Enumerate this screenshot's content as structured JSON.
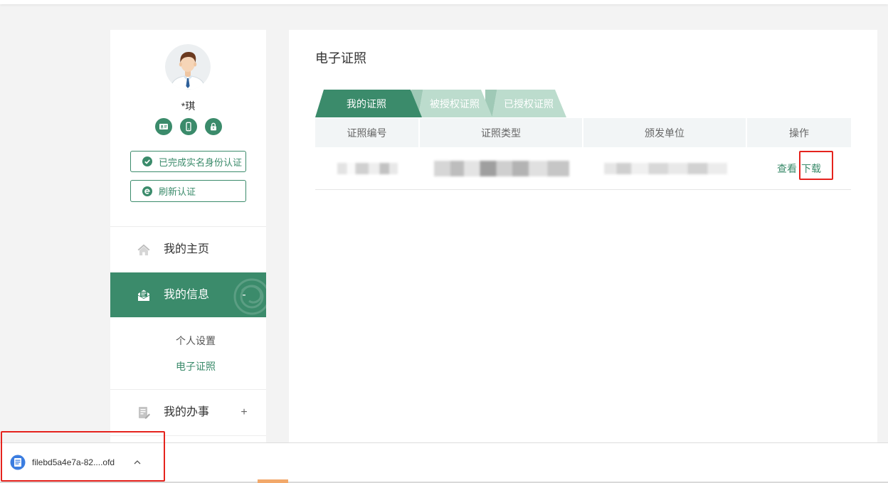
{
  "user": {
    "name": "*琪",
    "avatar": "avatar-man-icon",
    "badges": [
      "id-card-icon",
      "phone-icon",
      "lock-icon"
    ]
  },
  "auth": {
    "verified_label": "已完成实名身份认证",
    "verified_icon": "check-circle-icon",
    "refresh_label": "刷新认证",
    "refresh_icon": "refresh-icon"
  },
  "nav": {
    "home": {
      "label": "我的主页",
      "icon": "home-icon"
    },
    "info": {
      "label": "我的信息",
      "icon": "envelope-icon",
      "toggle": "-",
      "expanded": true,
      "sub_items": [
        {
          "label": "个人设置",
          "active": false
        },
        {
          "label": "电子证照",
          "active": true
        }
      ]
    },
    "affairs": {
      "label": "我的办事",
      "icon": "affairs-icon",
      "toggle": "+",
      "expanded": false
    }
  },
  "main": {
    "title": "电子证照",
    "tabs": [
      {
        "label": "我的证照",
        "active": true
      },
      {
        "label": "被授权证照",
        "active": false
      },
      {
        "label": "已授权证照",
        "active": false
      }
    ],
    "table": {
      "headers": [
        "证照编号",
        "证照类型",
        "颁发单位",
        "操作"
      ],
      "rows": [
        {
          "actions": {
            "view": "查看",
            "download": "下载"
          }
        }
      ]
    }
  },
  "download_bar": {
    "file_name": "filebd5a4e7a-82....ofd",
    "file_icon": "ofd-file-icon",
    "menu_icon": "chevron-up-icon"
  },
  "colors": {
    "accent": "#3b8b6b",
    "accent_light": "#bcdccd",
    "annotation_red": "#e5231d",
    "background": "#f3f3f3"
  }
}
